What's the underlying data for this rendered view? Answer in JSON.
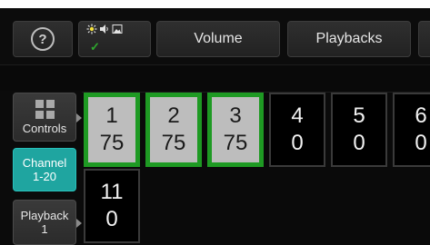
{
  "toolbar": {
    "help_glyph": "?",
    "volume_label": "Volume",
    "playbacks_label": "Playbacks",
    "media_icons": [
      "light-icon",
      "speaker-icon",
      "image-icon"
    ],
    "media_check": "✓"
  },
  "sidebar": {
    "controls_label": "Controls",
    "channel_label_line1": "Channel",
    "channel_label_line2": "1-20",
    "playback_label_line1": "Playback",
    "playback_label_line2": "1"
  },
  "channels": [
    {
      "number": "1",
      "value": "75",
      "selected": true
    },
    {
      "number": "2",
      "value": "75",
      "selected": true
    },
    {
      "number": "3",
      "value": "75",
      "selected": true
    },
    {
      "number": "4",
      "value": "0",
      "selected": false
    },
    {
      "number": "5",
      "value": "0",
      "selected": false
    },
    {
      "number": "6",
      "value": "0",
      "selected": false
    },
    {
      "number": "11",
      "value": "0",
      "selected": false
    }
  ],
  "colors": {
    "selected_border": "#1e9a23",
    "selected_fill": "#bdbdbd",
    "accent_teal": "#1fa5a0"
  }
}
